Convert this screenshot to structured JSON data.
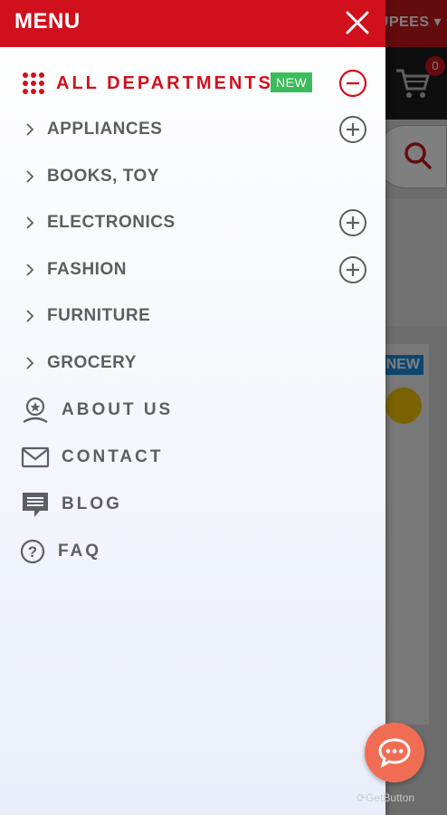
{
  "drawer": {
    "title": "MENU",
    "all_departments": {
      "label": "ALL DEPARTMENTS",
      "badge": "NEW"
    },
    "categories": [
      {
        "label": "APPLIANCES",
        "expandable": true
      },
      {
        "label": "BOOKS, TOY",
        "expandable": false
      },
      {
        "label": "ELECTRONICS",
        "expandable": true
      },
      {
        "label": "FASHION",
        "expandable": true
      },
      {
        "label": "FURNITURE",
        "expandable": false
      },
      {
        "label": "GROCERY",
        "expandable": false
      }
    ],
    "links": [
      {
        "label": "ABOUT US",
        "icon": "badge-icon"
      },
      {
        "label": "CONTACT",
        "icon": "envelope-icon"
      },
      {
        "label": "BLOG",
        "icon": "chat-bubble-icon"
      },
      {
        "label": "FAQ",
        "icon": "question-icon"
      }
    ]
  },
  "background_page": {
    "currency": "UPEES",
    "cart_count": "0",
    "new_badge": "NEW"
  },
  "widget": {
    "brand": "GetButton"
  },
  "colors": {
    "brand_red": "#d0101c",
    "new_green": "#3bbc5b",
    "text_gray": "#5b5f63",
    "chat_orange": "#f06d54"
  }
}
